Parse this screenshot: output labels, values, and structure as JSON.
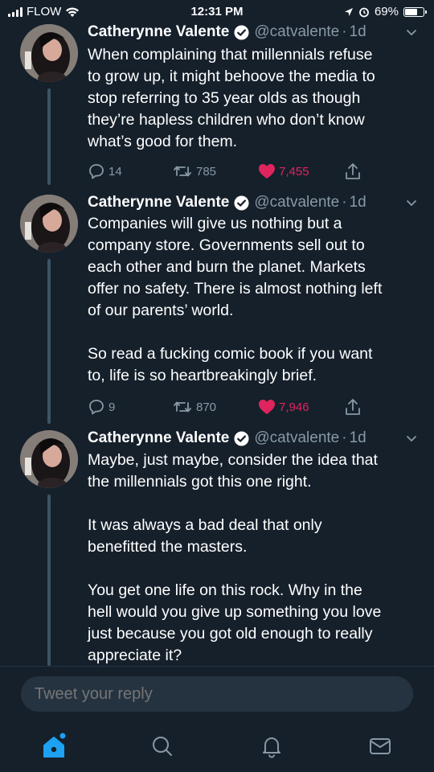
{
  "status": {
    "carrier": "FLOW",
    "time": "12:31 PM",
    "battery": "69%",
    "battery_level": 0.69
  },
  "tweets": [
    {
      "name": "Catherynne Valente",
      "handle": "@catvalente",
      "dot": "·",
      "time": "1d",
      "text": "When complaining that millennials refuse\nto grow up, it might behoove the media to\nstop referring to 35 year olds as though\nthey’re hapless children who don’t know\nwhat’s good for them.",
      "replies": "14",
      "retweets": "785",
      "likes": "7,455"
    },
    {
      "name": "Catherynne Valente",
      "handle": "@catvalente",
      "dot": "·",
      "time": "1d",
      "text": "Companies will give us nothing but a\ncompany store. Governments sell out to\neach other and burn the planet. Markets\noffer no safety. There is almost nothing left\nof our parents’ world.\n\nSo read a fucking comic book if you want\nto, life is so heartbreakingly brief.",
      "replies": "9",
      "retweets": "870",
      "likes": "7,946"
    },
    {
      "name": "Catherynne Valente",
      "handle": "@catvalente",
      "dot": "·",
      "time": "1d",
      "text": "Maybe, just maybe, consider the idea that\nthe millennials got this one right.\n\nIt was always a bad deal that only\nbenefitted the masters.\n\nYou get one life on this rock. Why in the\nhell would you give up something you love\njust because you got old enough to really\nappreciate it?"
    }
  ],
  "reply": {
    "placeholder": "Tweet your reply"
  },
  "tabs": [
    "home-icon",
    "search-icon",
    "notifications-icon",
    "messages-icon"
  ],
  "colors": {
    "background": "#15202b",
    "accent": "#1da1f2",
    "like": "#e0245e",
    "muted": "#8899a6"
  }
}
